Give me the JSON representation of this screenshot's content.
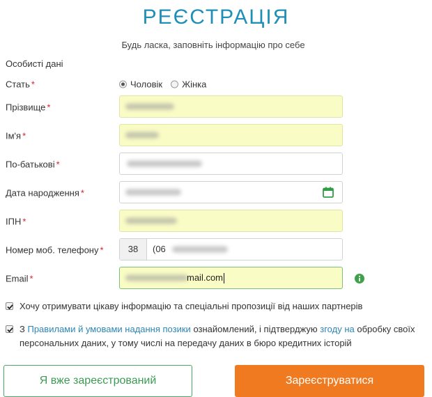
{
  "header": {
    "title": "РЕЄСТРАЦІЯ",
    "subtitle": "Будь ласка, заповніть інформацію про себе"
  },
  "section_title": "Особисті дані",
  "required_mark": "*",
  "gender": {
    "label": "Стать",
    "options": [
      "Чоловік",
      "Жінка"
    ],
    "selected": "Чоловік"
  },
  "fields": {
    "surname": {
      "label": "Прізвище",
      "value": ""
    },
    "name": {
      "label": "Ім'я",
      "value": ""
    },
    "patronymic": {
      "label": "По-батькові",
      "value": ""
    },
    "birthdate": {
      "label": "Дата народження",
      "value": ""
    },
    "ipn": {
      "label": "ІПН",
      "value": ""
    },
    "phone": {
      "label": "Номер моб. телефону",
      "prefix": "38",
      "value": "(06"
    },
    "email": {
      "label": "Email",
      "value": "mail.com"
    }
  },
  "checkboxes": {
    "partners": {
      "text": "Хочу отримувати цікаву інформацію та спеціальні пропозиції від наших партнерів",
      "checked": true
    },
    "terms": {
      "prefix": "З",
      "rules_link": "Правилами й умовами надання позики",
      "middle": "ознайомлений, і підтверджую",
      "consent_link": "згоду на",
      "suffix": "обробку своїх",
      "line2": "персональних даних, у тому числі на передачу даних в бюро кредитних історій",
      "checked": true
    }
  },
  "buttons": {
    "already_registered": "Я вже зареєстрований",
    "register": "Зареєструватися"
  },
  "colors": {
    "title": "#1f8fb6",
    "required": "#d9262b",
    "highlight_field": "#fafcc5",
    "primary_button": "#f07a20",
    "outline_button": "#4aa762",
    "link": "#2d86b3"
  },
  "icons": {
    "calendar": "calendar-icon",
    "info": "info-icon"
  }
}
